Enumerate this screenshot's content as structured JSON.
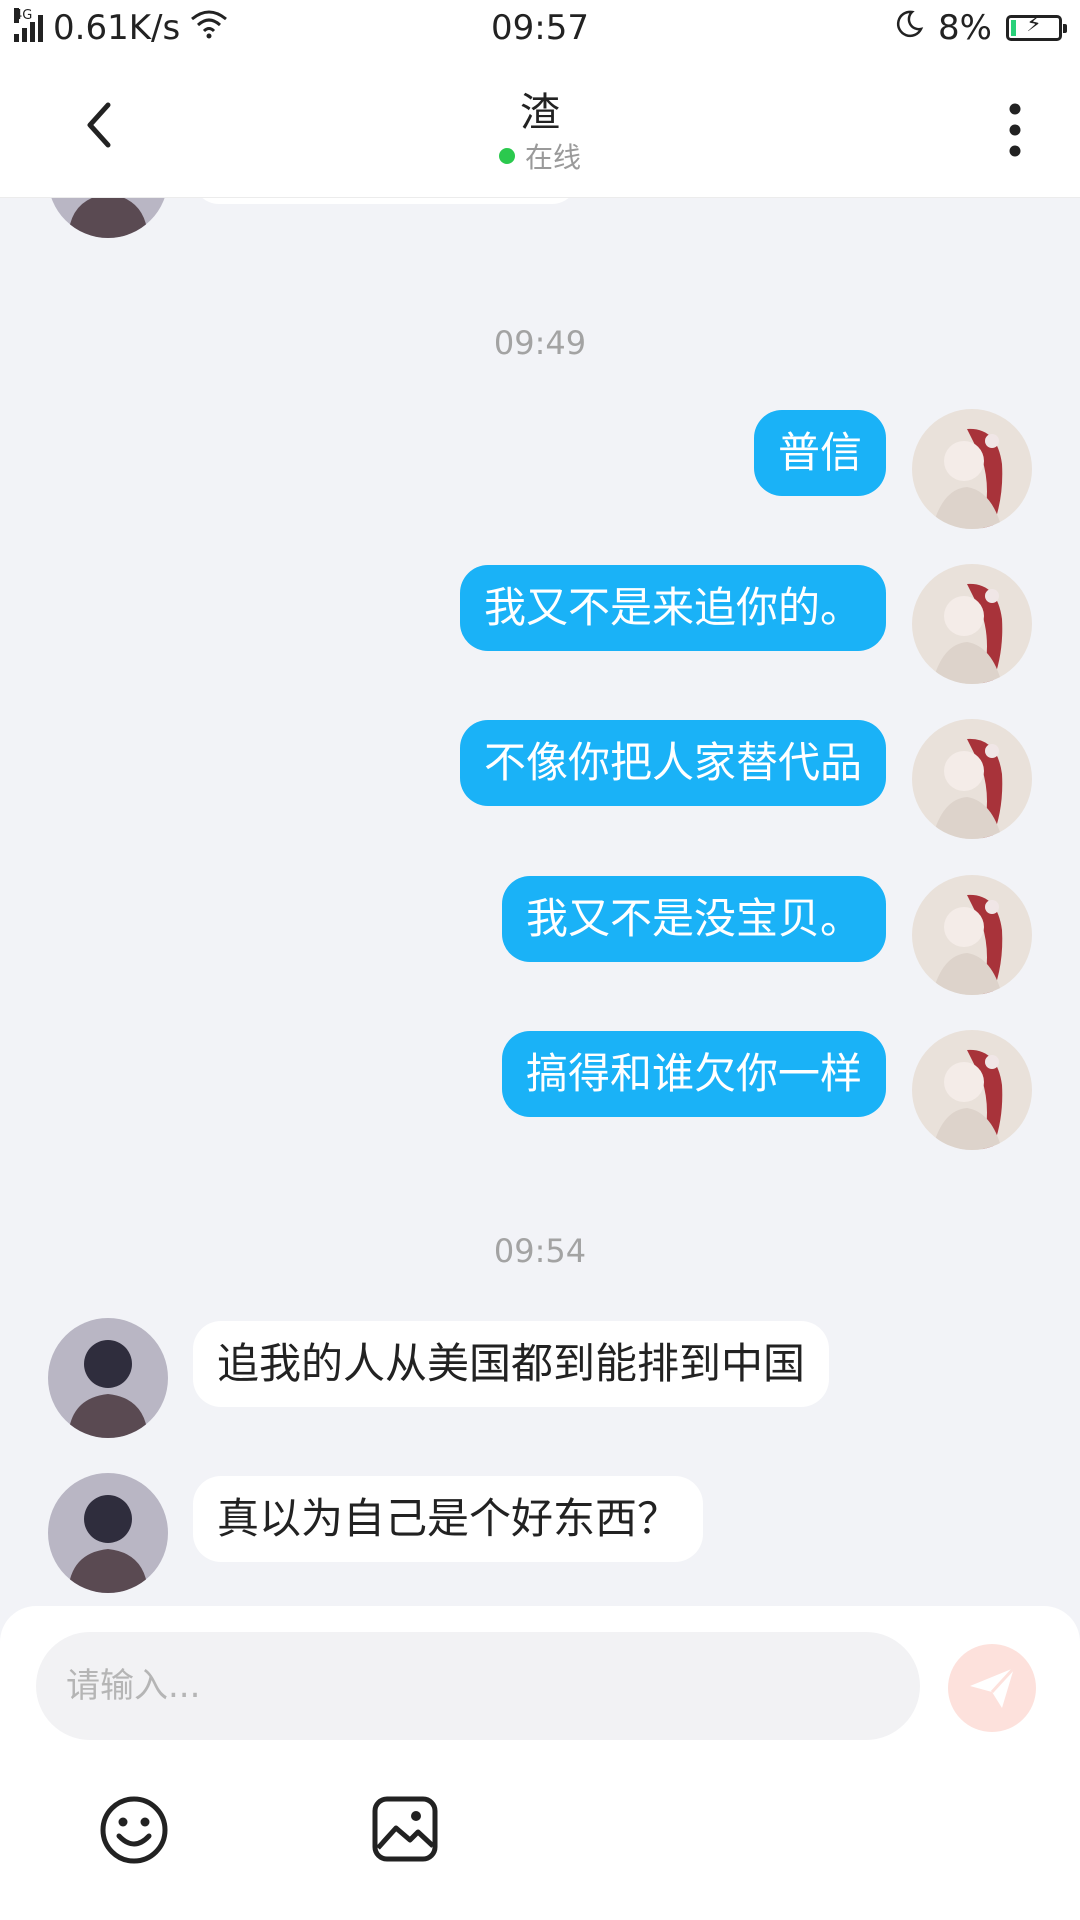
{
  "status_bar": {
    "network_type": "4G",
    "net_speed": "0.61K/s",
    "time": "09:57",
    "battery": "8%",
    "battery_level": 0.08
  },
  "header": {
    "title": "渣",
    "presence": "在线"
  },
  "chat": {
    "timestamps": [
      "09:49",
      "09:54"
    ],
    "outgoing": [
      "普信",
      "我又不是来追你的。",
      "不像你把人家替代品",
      "我又不是没宝贝。",
      "搞得和谁欠你一样"
    ],
    "incoming": [
      "追我的人从美国都到能排到中国",
      "真以为自己是个好东西？"
    ]
  },
  "input": {
    "placeholder": "请输入..."
  },
  "colors": {
    "outgoing_bubble": "#1ab2f7",
    "incoming_bubble": "#ffffff",
    "online_dot": "#2bc94e",
    "send_button": "#fde1dc",
    "background": "#f2f3f7"
  },
  "icons": {
    "back": "chevron-left-icon",
    "more": "more-vertical-icon",
    "send": "paper-plane-icon",
    "emoji": "smiley-icon",
    "image": "image-icon"
  }
}
